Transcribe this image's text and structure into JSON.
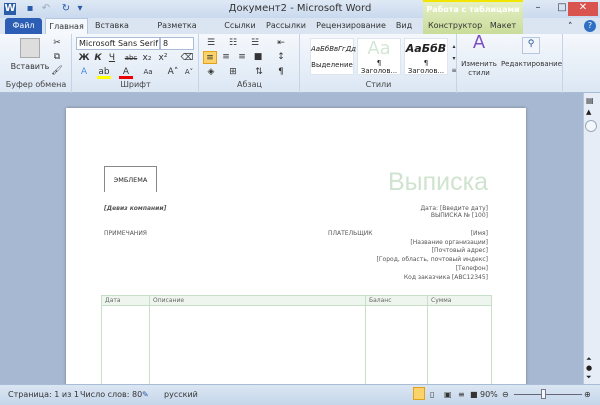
{
  "window": {
    "title": "Документ2 - Microsoft Word",
    "context_tab_group": "Работа с таблицами"
  },
  "tabs": [
    "Файл",
    "Главная",
    "Вставка",
    "Разметка страницы",
    "Ссылки",
    "Рассылки",
    "Рецензирование",
    "Вид",
    "Конструктор",
    "Макет"
  ],
  "ribbon": {
    "clipboard": {
      "label": "Буфер обмена",
      "paste": "Вставить"
    },
    "font": {
      "label": "Шрифт",
      "font_name": "Microsoft Sans Serif (С",
      "font_size": "8",
      "bold": "Ж",
      "italic": "К",
      "underline": "Ч",
      "strike": "abc",
      "sub": "x₂",
      "sup": "x²",
      "case": "Aa",
      "grow": "A˄",
      "shrink": "A˅"
    },
    "paragraph": {
      "label": "Абзац",
      "pilcrow": "¶"
    },
    "styles": {
      "label": "Стили",
      "items": [
        {
          "preview": "АаБбВвГгДд",
          "name": "Выделение"
        },
        {
          "preview": "Аа",
          "name": "¶ Заголов..."
        },
        {
          "preview": "АаБбВ",
          "name": "¶ Заголов..."
        }
      ],
      "change": "Изменить стили"
    },
    "editing": {
      "label": "Редактирование"
    }
  },
  "document": {
    "logo": "ЭМБЛЕМА",
    "heading": "Выписка",
    "motto": "[Девиз компании]",
    "date": "Дата: [Введите дату]",
    "number": "ВЫПИСКА № [100]",
    "notes": "ПРИМЕЧАНИЯ",
    "payer": "ПЛАТЕЛЬЩИК",
    "payer_lines": [
      "[Имя]",
      "[Название организации]",
      "[Почтовый адрес]",
      "[Город, область, почтовый индекс]",
      "[Телефон]",
      "Код заказчика [ABC12345]"
    ],
    "table_headers": [
      "Дата",
      "Описание",
      "Баланс",
      "Сумма"
    ],
    "accent": "#c6dfc6"
  },
  "status": {
    "page": "Страница: 1 из 1",
    "words": "Число слов: 80",
    "language": "русский",
    "zoom": "90%",
    "zoom_percent": 90
  }
}
